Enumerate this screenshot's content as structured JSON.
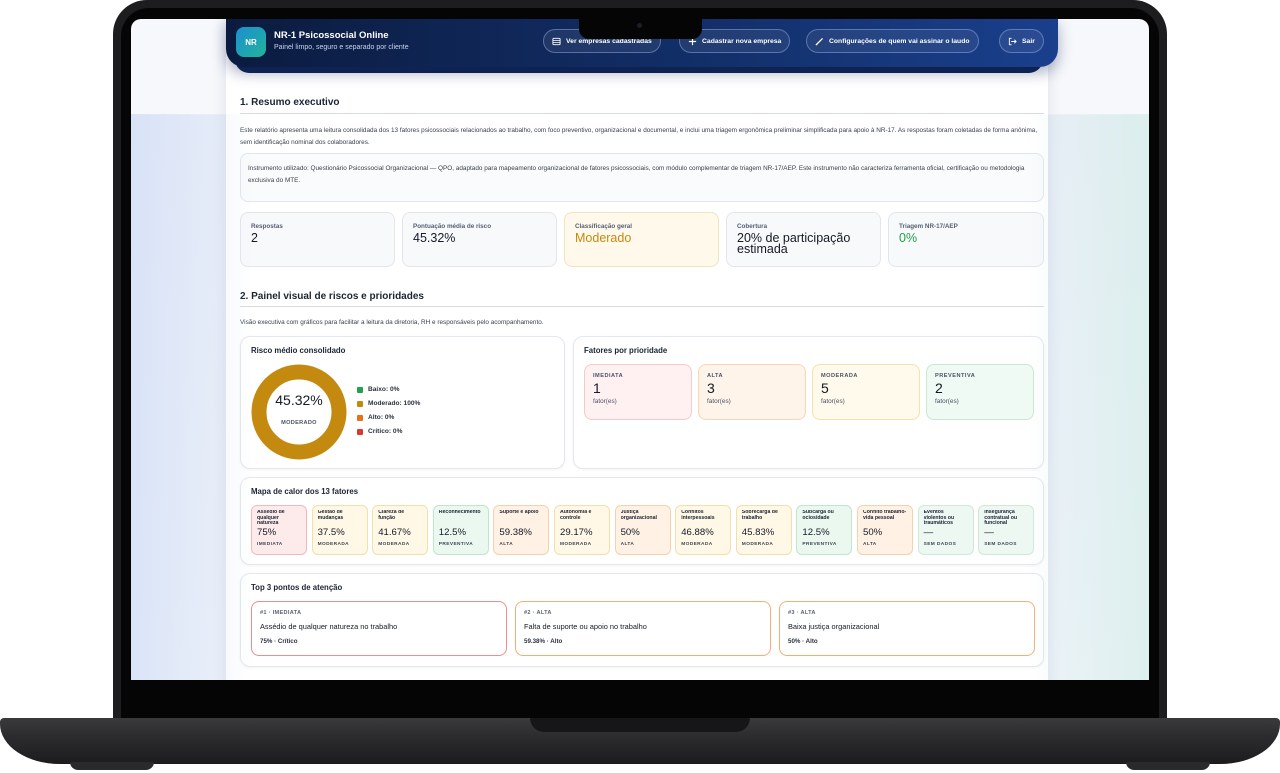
{
  "header": {
    "logo_text": "NR",
    "title": "NR-1 Psicossocial Online",
    "subtitle": "Painel limpo, seguro e separado por cliente",
    "buttons": {
      "list": "Ver empresas cadastradas",
      "add": "Cadastrar nova empresa",
      "signer": "Configurações de quem vai assinar o laudo",
      "logout": "Sair"
    }
  },
  "summary": {
    "title": "1. Resumo executivo",
    "intro": "Este relatório apresenta uma leitura consolidada dos 13 fatores psicossociais relacionados ao trabalho, com foco preventivo, organizacional e documental, e inclui uma triagem ergonômica preliminar simplificada para apoio à NR-17. As respostas foram coletadas de forma anônima, sem identificação nominal dos colaboradores.",
    "instrument": "Instrumento utilizado: Questionário Psicossocial Organizacional — QPO, adaptado para mapeamento organizacional de fatores psicossociais, com módulo complementar de triagem NR-17/AEP. Este instrumento não caracteriza ferramenta oficial, certificação ou metodologia exclusiva do MTE.",
    "kpis": [
      {
        "label": "Respostas",
        "value": "2",
        "color": "#141a26"
      },
      {
        "label": "Pontuação média de risco",
        "value": "45.32%",
        "color": "#141a26"
      },
      {
        "label": "Classificação geral",
        "value": "Moderado",
        "color": "#c48a0f"
      },
      {
        "label": "Cobertura",
        "value": "20% de participação estimada",
        "color": "#141a26"
      },
      {
        "label": "Triagem NR-17/AEP",
        "value": "0%",
        "color": "#22a04a"
      }
    ]
  },
  "panel": {
    "title": "2. Painel visual de riscos e prioridades",
    "intro": "Visão executiva com gráficos para facilitar a leitura da diretoria, RH e responsáveis pelo acompanhamento.",
    "risk": {
      "title": "Risco médio consolidado",
      "value": "45.32%",
      "label": "MODERADO",
      "ring_color": "#c48a0f",
      "legend": [
        {
          "label": "Baixo: 0%",
          "color": "#22a04a"
        },
        {
          "label": "Moderado: 100%",
          "color": "#c48a0f"
        },
        {
          "label": "Alto: 0%",
          "color": "#e8711c"
        },
        {
          "label": "Crítico: 0%",
          "color": "#d93a2b"
        }
      ]
    },
    "priority": {
      "title": "Fatores por prioridade",
      "unit": "fator(es)",
      "items": [
        {
          "label": "IMEDIATA",
          "value": "1",
          "bg": "#fff1f1",
          "border": "#f6caca"
        },
        {
          "label": "ALTA",
          "value": "3",
          "bg": "#fff4ea",
          "border": "#f7d6b6"
        },
        {
          "label": "MODERADA",
          "value": "5",
          "bg": "#fffaeb",
          "border": "#f4e2ad"
        },
        {
          "label": "PREVENTIVA",
          "value": "2",
          "bg": "#eefaf3",
          "border": "#c6e9d3"
        }
      ]
    },
    "heatmap": {
      "title": "Mapa de calor dos 13 fatores",
      "items": [
        {
          "name": "Assédio de qualquer natureza",
          "value": "75%",
          "tag": "IMEDIATA",
          "bg": "#fdeaea",
          "border": "#f3b9b9"
        },
        {
          "name": "Gestão de mudanças",
          "value": "37.5%",
          "tag": "MODERADA",
          "bg": "#fff8e6",
          "border": "#f2e0aa"
        },
        {
          "name": "Clareza de função",
          "value": "41.67%",
          "tag": "MODERADA",
          "bg": "#fff8e6",
          "border": "#f2e0aa"
        },
        {
          "name": "Reconhecimento",
          "value": "12.5%",
          "tag": "PREVENTIVA",
          "bg": "#ebf8f0",
          "border": "#bfe5cd"
        },
        {
          "name": "Suporte e apoio",
          "value": "59.38%",
          "tag": "ALTA",
          "bg": "#fff1e4",
          "border": "#f5d1ae"
        },
        {
          "name": "Autonomia e controle",
          "value": "29.17%",
          "tag": "MODERADA",
          "bg": "#fff8e6",
          "border": "#f2e0aa"
        },
        {
          "name": "Justiça organizacional",
          "value": "50%",
          "tag": "ALTA",
          "bg": "#fff1e4",
          "border": "#f5d1ae"
        },
        {
          "name": "Conflitos interpessoais",
          "value": "46.88%",
          "tag": "MODERADA",
          "bg": "#fff8e6",
          "border": "#f2e0aa"
        },
        {
          "name": "Sobrecarga de trabalho",
          "value": "45.83%",
          "tag": "MODERADA",
          "bg": "#fff8e6",
          "border": "#f2e0aa"
        },
        {
          "name": "Subcarga ou ociosidade",
          "value": "12.5%",
          "tag": "PREVENTIVA",
          "bg": "#ebf8f0",
          "border": "#bfe5cd"
        },
        {
          "name": "Conflito trabalho-vida pessoal",
          "value": "50%",
          "tag": "ALTA",
          "bg": "#fff1e4",
          "border": "#f5d1ae"
        },
        {
          "name": "Eventos violentos ou traumáticos",
          "value": "—",
          "tag": "SEM DADOS",
          "bg": "#eef8f2",
          "border": "#cfe9d9"
        },
        {
          "name": "Insegurança contratual ou funcional",
          "value": "—",
          "tag": "SEM DADOS",
          "bg": "#eef8f2",
          "border": "#cfe9d9"
        }
      ]
    },
    "top3": {
      "title": "Top 3 pontos de atenção",
      "items": [
        {
          "tag": "#1 · IMEDIATA",
          "name": "Assédio de qualquer natureza no trabalho",
          "value": "75% · Crítico",
          "border": "#ef8c8c"
        },
        {
          "tag": "#2 · ALTA",
          "name": "Falta de suporte ou apoio no trabalho",
          "value": "59.38% · Alto",
          "border": "#f0b074"
        },
        {
          "tag": "#3 · ALTA",
          "name": "Baixa justiça organizacional",
          "value": "50% · Alto",
          "border": "#f0b074"
        }
      ]
    }
  }
}
